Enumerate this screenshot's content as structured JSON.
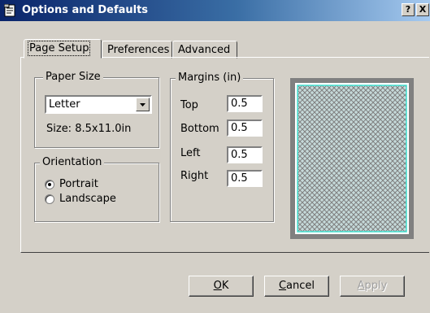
{
  "window": {
    "title": "Options and Defaults",
    "help_label": "?",
    "close_label": "X"
  },
  "tabs": [
    {
      "label": "Page Setup",
      "active": true
    },
    {
      "label": "Preferences",
      "active": false
    },
    {
      "label": "Advanced",
      "active": false
    }
  ],
  "paper_size": {
    "group_label": "Paper Size",
    "selected": "Letter",
    "size_text": "Size: 8.5x11.0in"
  },
  "orientation": {
    "group_label": "Orientation",
    "options": [
      {
        "label": "Portrait",
        "checked": true
      },
      {
        "label": "Landscape",
        "checked": false
      }
    ]
  },
  "margins": {
    "group_label": "Margins (in)",
    "fields": [
      {
        "label": "Top",
        "value": "0.5"
      },
      {
        "label": "Bottom",
        "value": "0.5"
      },
      {
        "label": "Left",
        "value": "0.5"
      },
      {
        "label": "Right",
        "value": "0.5"
      }
    ]
  },
  "buttons": {
    "ok": {
      "mnemonic": "O",
      "rest": "K"
    },
    "cancel": {
      "mnemonic": "C",
      "rest": "ancel"
    },
    "apply": {
      "mnemonic": "A",
      "rest": "pply"
    }
  },
  "colors": {
    "title_start": "#0a246a",
    "title_end": "#a6caf0",
    "preview_margin_line": "#40e0d0",
    "preview_frame": "#808080"
  }
}
